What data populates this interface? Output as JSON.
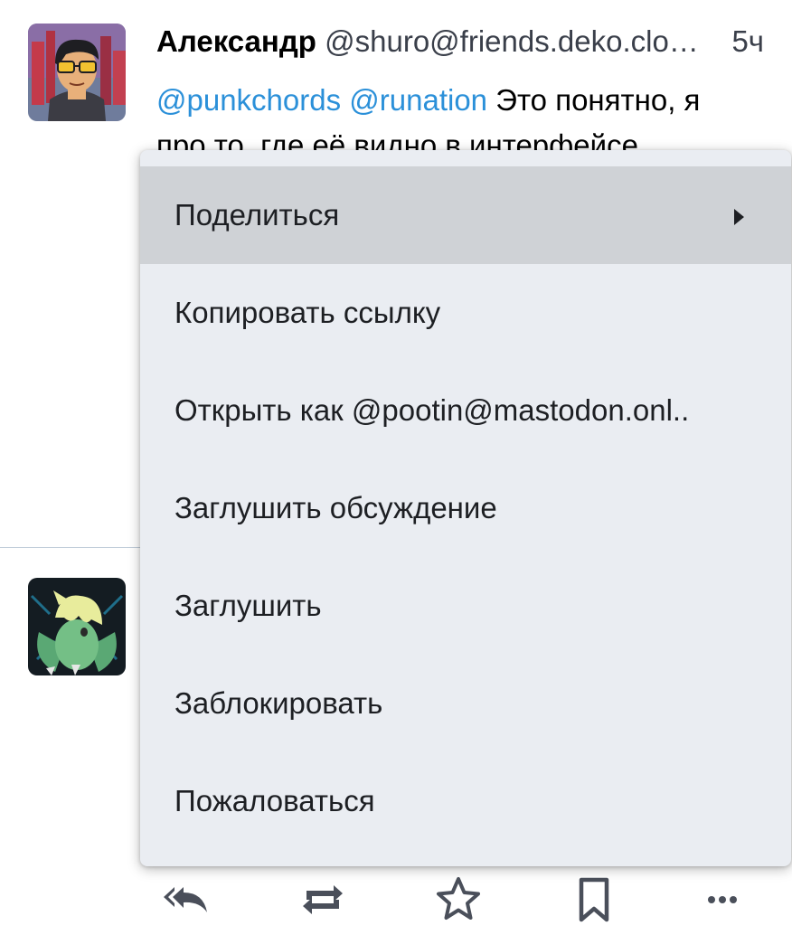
{
  "status": {
    "display_name": "Александр",
    "handle": "@shuro@friends.deko.clo…",
    "timestamp": "5ч",
    "mention_1": "@punkchords",
    "mention_2": "@runation",
    "text_line_1": "Это понятно, я",
    "text_line_2": "про то, где её видно в интерфейсе."
  },
  "context_menu": {
    "items": [
      {
        "label": "Поделиться",
        "has_submenu": true,
        "highlighted": true
      },
      {
        "label": "Копировать ссылку"
      },
      {
        "label": "Открыть как @pootin@mastodon.onl.."
      },
      {
        "label": "Заглушить обсуждение"
      },
      {
        "label": "Заглушить"
      },
      {
        "label": "Заблокировать"
      },
      {
        "label": "Пожаловаться"
      }
    ]
  },
  "action_bar": {
    "icons": [
      "reply-all-icon",
      "boost-icon",
      "star-icon",
      "bookmark-icon",
      "more-icon"
    ]
  },
  "colors": {
    "mention": "#2b90d9",
    "menu_background": "#eaedf2",
    "menu_highlight": "#cfd2d6",
    "icon": "#4a4f5a"
  }
}
